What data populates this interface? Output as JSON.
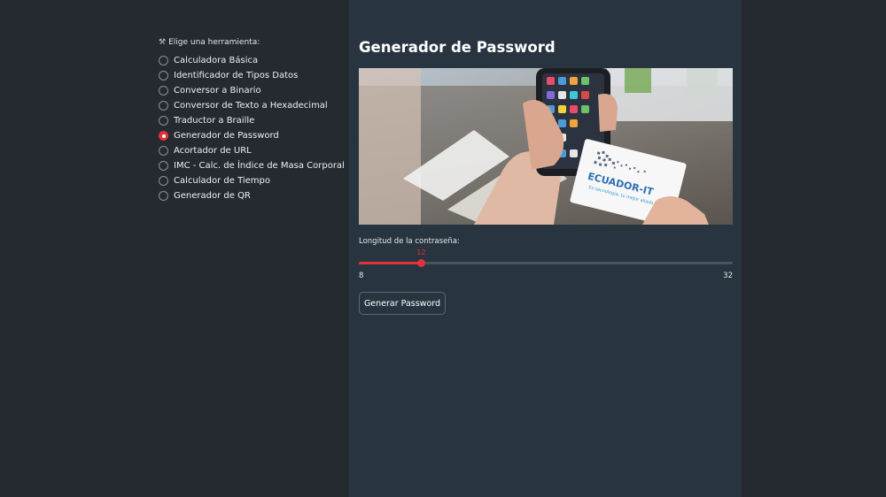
{
  "sidebar": {
    "radio_title": "Elige una herramienta:",
    "radio_title_icon": "tools-icon",
    "options": [
      {
        "label": "Calculadora Básica",
        "selected": false
      },
      {
        "label": "Identificador de Tipos Datos",
        "selected": false
      },
      {
        "label": "Conversor a Binario",
        "selected": false
      },
      {
        "label": "Conversor de Texto a Hexadecimal",
        "selected": false
      },
      {
        "label": "Traductor a Braille",
        "selected": false
      },
      {
        "label": "Generador de Password",
        "selected": true
      },
      {
        "label": "Acortador de URL",
        "selected": false
      },
      {
        "label": "IMC - Calc. de Índice de Masa Corporal",
        "selected": false
      },
      {
        "label": "Calculador de Tiempo",
        "selected": false
      },
      {
        "label": "Generador de QR",
        "selected": false
      }
    ]
  },
  "main": {
    "title": "Generador de Password",
    "hero_card_text": "ECUADOR-IT",
    "hero_card_subtext": "En tecnología, tu mejor aliado",
    "slider": {
      "label": "Longitud de la contraseña:",
      "value": 12,
      "min": 8,
      "max": 32,
      "min_label": "8",
      "max_label": "32",
      "value_label": "12"
    },
    "button_label": "Generar Password"
  },
  "colors": {
    "accent": "#e0333a",
    "sidebar_bg": "#242a30",
    "main_bg": "#283540"
  }
}
